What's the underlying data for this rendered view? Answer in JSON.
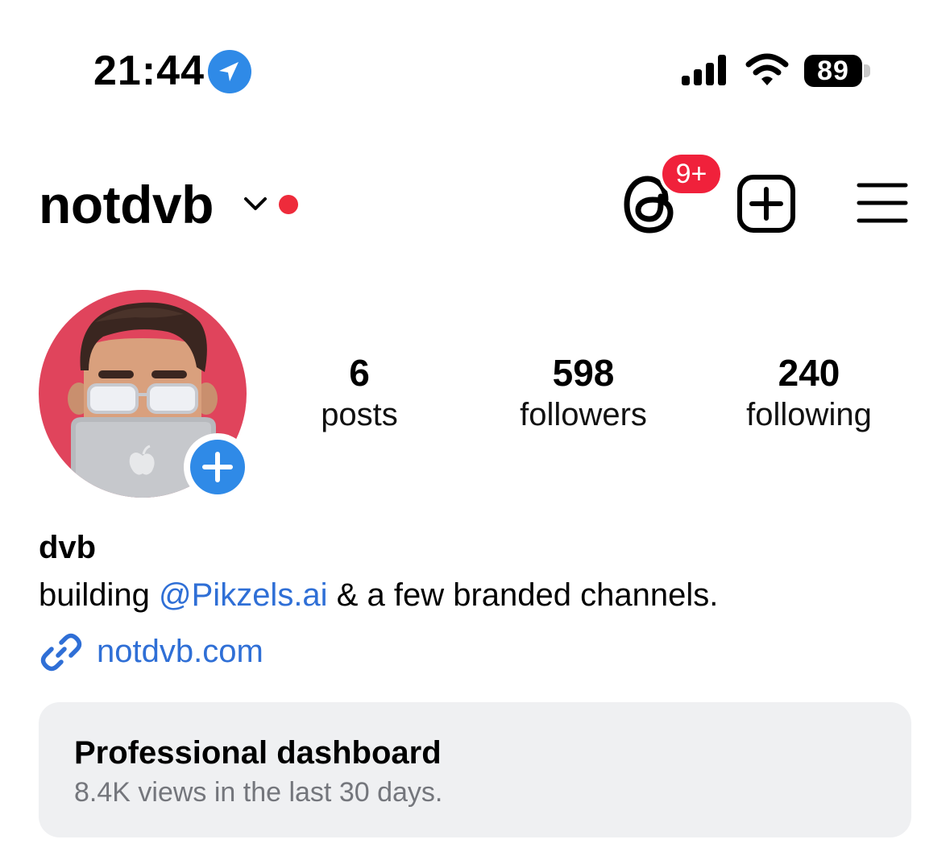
{
  "status_bar": {
    "time": "21:44",
    "battery": "89",
    "icons": [
      "location-arrow-icon",
      "cellular-signal-icon",
      "wifi-icon",
      "battery-icon"
    ]
  },
  "header": {
    "username": "notdvb",
    "notification_badge": "9+",
    "icons": [
      "chevron-down-icon",
      "threads-icon",
      "create-plus-icon",
      "hamburger-menu-icon"
    ]
  },
  "profile": {
    "stats": [
      {
        "value": "6",
        "label": "posts"
      },
      {
        "value": "598",
        "label": "followers"
      },
      {
        "value": "240",
        "label": "following"
      }
    ],
    "display_name": "dvb",
    "bio": {
      "prefix": "building ",
      "mention": "@Pikzels.ai",
      "suffix": " & a few branded channels."
    },
    "link": "notdvb.com"
  },
  "dashboard": {
    "title": "Professional dashboard",
    "subtitle": "8.4K views in the last 30 days."
  },
  "colors": {
    "accent_blue": "#2f8ae7",
    "link_blue": "#2f6fd6",
    "badge_red": "#f0213b",
    "avatar_bg": "#e0445c",
    "card_bg": "#eff0f2"
  }
}
